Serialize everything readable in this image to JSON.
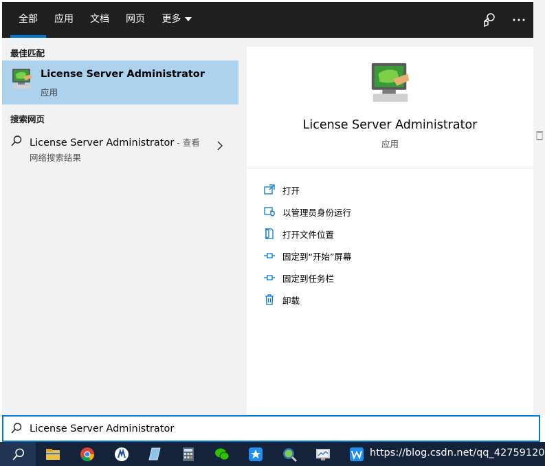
{
  "tabs": [
    {
      "label": "全部"
    },
    {
      "label": "应用"
    },
    {
      "label": "文档"
    },
    {
      "label": "网页"
    },
    {
      "label": "更多"
    }
  ],
  "left": {
    "best_match_heading": "最佳匹配",
    "best_match": {
      "name": "License Server Administrator",
      "type": "应用"
    },
    "web_heading": "搜索网页",
    "web_result": {
      "name": "License Server Administrator",
      "suffix": " - 查看",
      "sub": "网络搜索结果"
    }
  },
  "detail": {
    "title": "License Server Administrator",
    "type": "应用",
    "actions": [
      {
        "label": "打开",
        "icon": "open-icon"
      },
      {
        "label": "以管理员身份运行",
        "icon": "shield-icon"
      },
      {
        "label": "打开文件位置",
        "icon": "file-location-icon"
      },
      {
        "label": "固定到“开始”屏幕",
        "icon": "pin-icon"
      },
      {
        "label": "固定到任务栏",
        "icon": "pin-icon"
      },
      {
        "label": "卸载",
        "icon": "trash-icon"
      }
    ]
  },
  "search": {
    "value": "License Server Administrator"
  },
  "taskbar": {
    "watermark": "https://blog.csdn.net/qq_42759120",
    "apps": [
      "file-explorer-icon",
      "chrome-icon",
      "app-icon",
      "notes-icon",
      "calculator-icon",
      "wechat-icon",
      "star-app-icon",
      "magnifier-app-icon",
      "monitor-icon",
      "wps-icon"
    ]
  },
  "colors": {
    "accent": "#0078d7",
    "selected": "#add2ed",
    "topbar": "#1f1f1f",
    "taskbar": "#14233a"
  }
}
